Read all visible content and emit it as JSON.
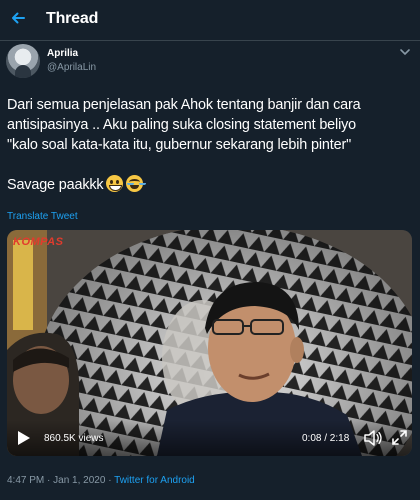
{
  "header": {
    "title": "Thread"
  },
  "tweet": {
    "author_name": "Aprilia",
    "author_handle": "@AprilaLin",
    "lines": [
      "Dari semua penjelasan pak Ahok tentang banjir dan cara",
      "antisipasinya .. Aku paling suka closing statement beliyo",
      "\"kalo soal kata-kata itu, gubernur sekarang lebih pinter\""
    ],
    "closing": "Savage paakkk",
    "emojis": [
      "grinning-face-emoji",
      "face-with-tears-of-joy-emoji"
    ],
    "translate_label": "Translate Tweet"
  },
  "video": {
    "watermark": "KOMPAS",
    "views": "860.5K views",
    "time": "0:08 / 2:18"
  },
  "footer": {
    "time": "4:47 PM",
    "date": "Jan 1, 2020",
    "app": "Twitter for Android",
    "separator": "·"
  },
  "colors": {
    "background": "#15202b",
    "accent": "#1da1f2",
    "secondary_text": "#8899a6",
    "divider": "#38444d"
  }
}
